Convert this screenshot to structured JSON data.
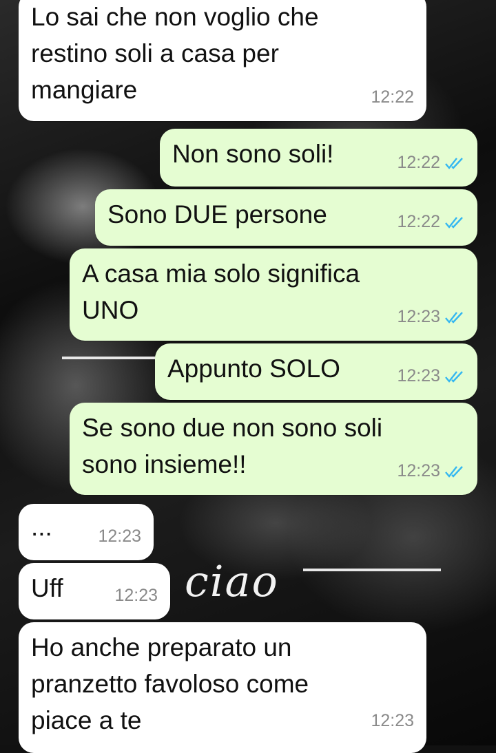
{
  "colors": {
    "incoming_bubble": "#ffffff",
    "outgoing_bubble": "#e5fdd2",
    "read_tick": "#34b7f1",
    "time_text": "#8a8a8a"
  },
  "wallpaper": {
    "script_text": "ciao"
  },
  "messages": [
    {
      "direction": "in",
      "text": "Lo sai che non voglio che\nrestino soli a casa per\nmangiare",
      "time": "12:22"
    },
    {
      "direction": "out",
      "text": "Non sono soli!",
      "time": "12:22",
      "status": "read"
    },
    {
      "direction": "out",
      "text": "Sono DUE persone",
      "time": "12:22",
      "status": "read"
    },
    {
      "direction": "out",
      "text": "A casa mia solo significa\nUNO",
      "time": "12:23",
      "status": "read"
    },
    {
      "direction": "out",
      "text": "Appunto SOLO",
      "time": "12:23",
      "status": "read"
    },
    {
      "direction": "out",
      "text": "Se sono due non sono soli\nsono insieme!!",
      "time": "12:23",
      "status": "read"
    },
    {
      "direction": "in",
      "text": "...",
      "time": "12:23"
    },
    {
      "direction": "in",
      "text": "Uff",
      "time": "12:23"
    },
    {
      "direction": "in",
      "text": "Ho anche preparato un\npranzetto favoloso come\npiace a te",
      "time": "12:23"
    }
  ]
}
